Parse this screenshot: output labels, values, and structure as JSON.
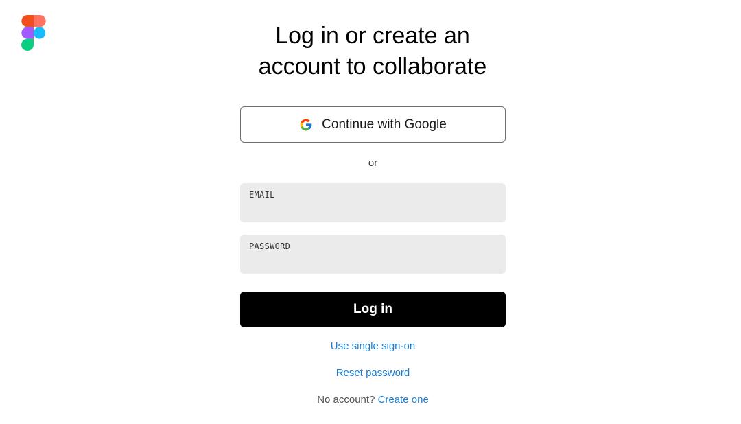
{
  "brand": {
    "logo_icon": "figma-logo-icon",
    "logo_colors": [
      "#F24E1E",
      "#FF7262",
      "#A259FF",
      "#1ABCFE",
      "#0ACF83"
    ]
  },
  "heading": {
    "line1": "Log in or create an",
    "line2": "account to collaborate"
  },
  "google_button": {
    "icon": "google-g-icon",
    "label": "Continue with Google"
  },
  "separator": {
    "text": "or"
  },
  "fields": {
    "email": {
      "label": "EMAIL",
      "value": ""
    },
    "password": {
      "label": "PASSWORD",
      "value": ""
    }
  },
  "login_button": {
    "label": "Log in"
  },
  "links": {
    "sso": "Use single sign-on",
    "reset_password": "Reset password",
    "no_account_prompt": "No account?",
    "create_account": "Create one"
  },
  "colors": {
    "link": "#1a7fd4",
    "primary_button_bg": "#000000",
    "field_bg": "#ebebeb"
  }
}
